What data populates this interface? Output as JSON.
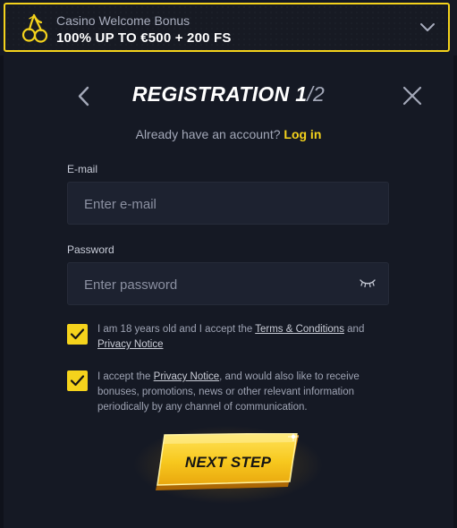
{
  "bonus": {
    "subtitle": "Casino Welcome Bonus",
    "offer": "100% UP TO €500 + 200 FS",
    "icon": "cherries-icon",
    "accent": "#f5d31c"
  },
  "header": {
    "title_main": "REGISTRATION 1",
    "title_step": "/2"
  },
  "login_prompt": {
    "text": "Already have an account?",
    "link": "Log in"
  },
  "form": {
    "email": {
      "label": "E-mail",
      "placeholder": "Enter e-mail",
      "value": ""
    },
    "password": {
      "label": "Password",
      "placeholder": "Enter password",
      "value": ""
    }
  },
  "consents": [
    {
      "checked": true,
      "before": "I am 18 years old and I accept the ",
      "link1": "Terms & Conditions",
      "middle": " and ",
      "link2": "Privacy Notice"
    },
    {
      "checked": true,
      "before": "I accept the ",
      "link1": "Privacy Notice",
      "after": ", and would also like to receive bonuses, promotions, news or other relevant information periodically by any channel of communication."
    }
  ],
  "next_button": {
    "label": "NEXT STEP"
  },
  "colors": {
    "background": "#151924",
    "input_bg": "#1d2230",
    "accent_yellow": "#f5d31c",
    "muted_text": "#a3a8b8"
  }
}
